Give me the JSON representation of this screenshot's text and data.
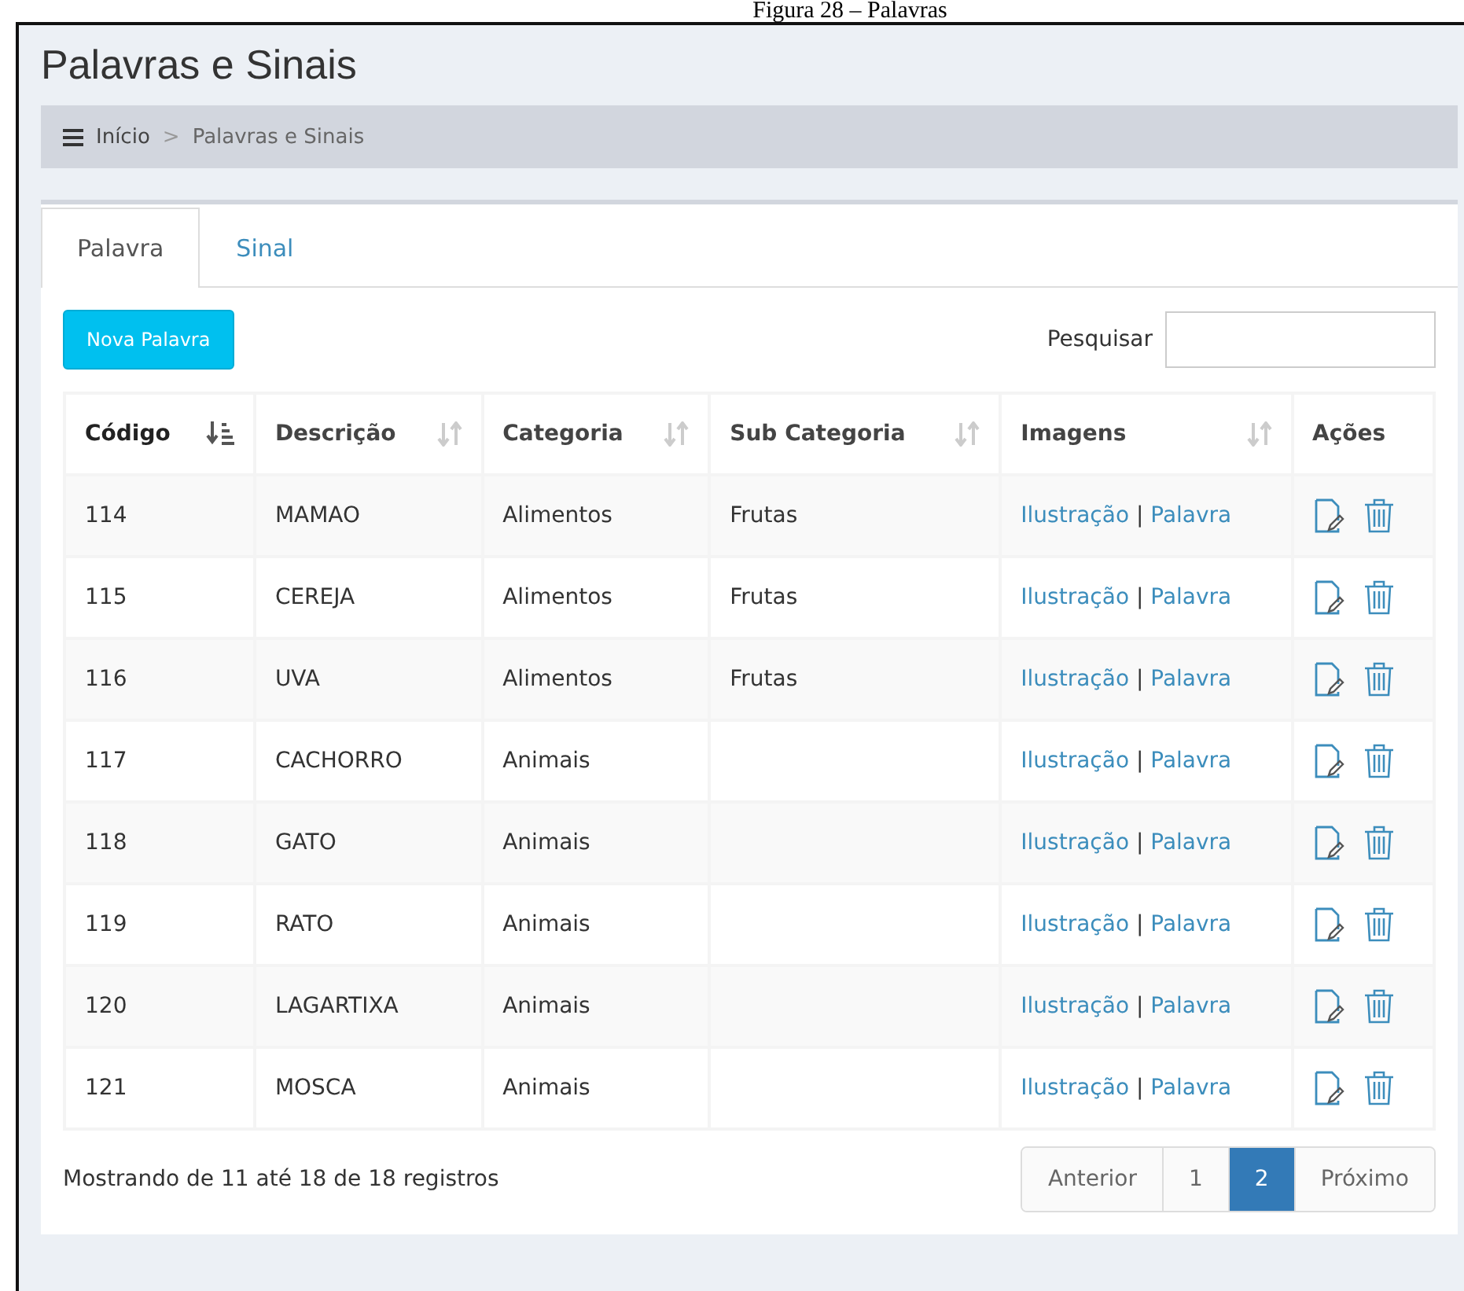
{
  "caption": "Figura 28 – Palavras",
  "page_title": "Palavras e Sinais",
  "breadcrumb": {
    "home": "Início",
    "separator": ">",
    "current": "Palavras e Sinais"
  },
  "tabs": [
    {
      "label": "Palavra",
      "selected": true
    },
    {
      "label": "Sinal",
      "selected": false
    }
  ],
  "new_button": "Nova Palavra",
  "search": {
    "label": "Pesquisar"
  },
  "table": {
    "columns": [
      {
        "label": "Código",
        "sortable": true,
        "sorted": true
      },
      {
        "label": "Descrição",
        "sortable": true,
        "sorted": false
      },
      {
        "label": "Categoria",
        "sortable": true,
        "sorted": false
      },
      {
        "label": "Sub Categoria",
        "sortable": true,
        "sorted": false
      },
      {
        "label": "Imagens",
        "sortable": true,
        "sorted": false
      },
      {
        "label": "Ações",
        "sortable": false
      }
    ],
    "rows": [
      {
        "code": "114",
        "description": "MAMAO",
        "category": "Alimentos",
        "subcategory": "Frutas",
        "link_1": "Ilustração",
        "link_2": "Palavra"
      },
      {
        "code": "115",
        "description": "CEREJA",
        "category": "Alimentos",
        "subcategory": "Frutas",
        "link_1": "Ilustração",
        "link_2": "Palavra"
      },
      {
        "code": "116",
        "description": "UVA",
        "category": "Alimentos",
        "subcategory": "Frutas",
        "link_1": "Ilustração",
        "link_2": "Palavra"
      },
      {
        "code": "117",
        "description": "CACHORRO",
        "category": "Animais",
        "link_1": "Ilustração",
        "link_2": "Palavra"
      },
      {
        "code": "118",
        "description": "GATO",
        "category": "Animais",
        "link_1": "Ilustração",
        "link_2": "Palavra"
      },
      {
        "code": "119",
        "description": "RATO",
        "category": "Animais",
        "link_1": "Ilustração",
        "link_2": "Palavra"
      },
      {
        "code": "120",
        "description": "LAGARTIXA",
        "category": "Animais",
        "link_1": "Ilustração",
        "link_2": "Palavra"
      },
      {
        "code": "121",
        "description": "MOSCA",
        "category": "Animais",
        "link_1": "Ilustração",
        "link_2": "Palavra"
      }
    ],
    "link_separator": "|"
  },
  "info": "Mostrando de 11 até 18 de 18 registros",
  "pagination": [
    {
      "label": "Anterior",
      "selected": false
    },
    {
      "label": "1",
      "selected": false
    },
    {
      "label": "2",
      "selected": true
    },
    {
      "label": "Próximo",
      "selected": false
    }
  ]
}
